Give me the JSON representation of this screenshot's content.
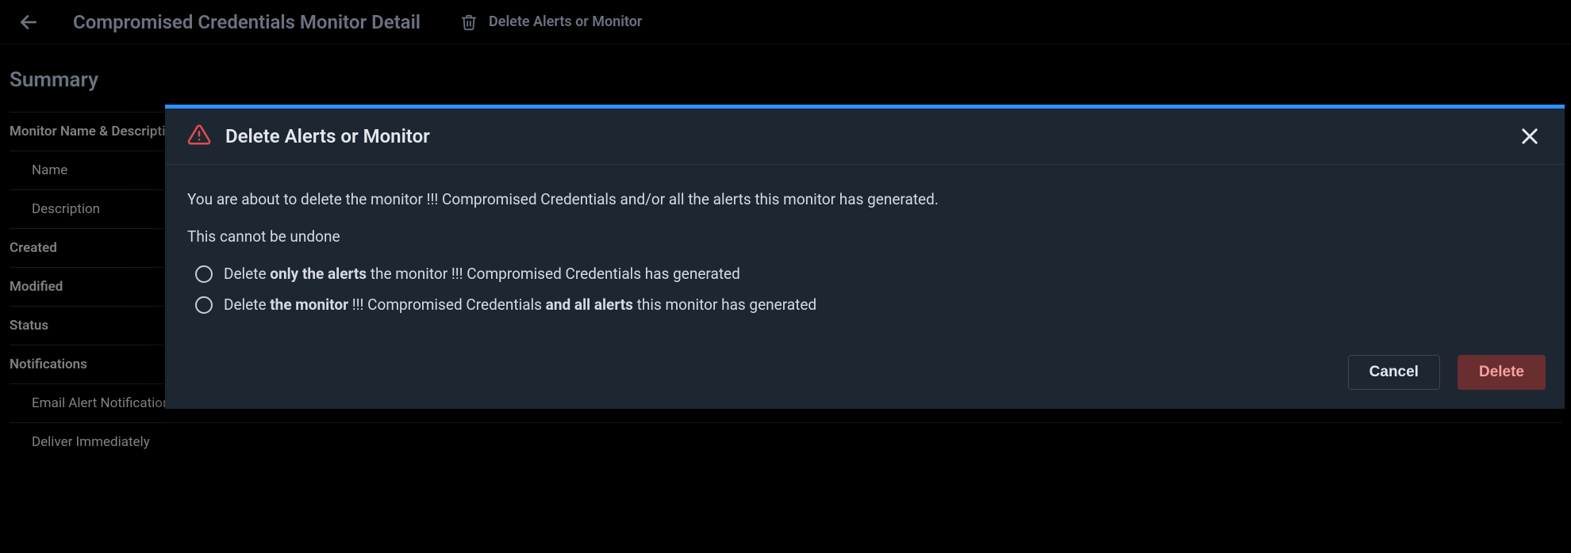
{
  "header": {
    "page_title": "Compromised Credentials Monitor Detail",
    "delete_action_label": "Delete Alerts or Monitor"
  },
  "summary": {
    "heading": "Summary",
    "group_name_desc": "Monitor Name & Description",
    "row_name": "Name",
    "row_description": "Description",
    "row_created": "Created",
    "row_modified": "Modified",
    "row_status": "Status",
    "group_notifications": "Notifications",
    "row_email_notif": "Email Alert Notification",
    "row_deliver": "Deliver Immediately"
  },
  "modal": {
    "title": "Delete Alerts or Monitor",
    "warning_line1": "You are about to delete the monitor !!! Compromised Credentials and/or all the alerts this monitor has generated.",
    "warning_line2": "This cannot be undone",
    "option1": {
      "prefix": "Delete ",
      "bold": "only the alerts",
      "suffix": " the monitor !!! Compromised Credentials has generated"
    },
    "option2": {
      "prefix": "Delete ",
      "bold1": "the monitor",
      "mid": " !!! Compromised Credentials ",
      "bold2": "and all alerts",
      "suffix": " this monitor has generated"
    },
    "cancel_label": "Cancel",
    "delete_label": "Delete"
  }
}
